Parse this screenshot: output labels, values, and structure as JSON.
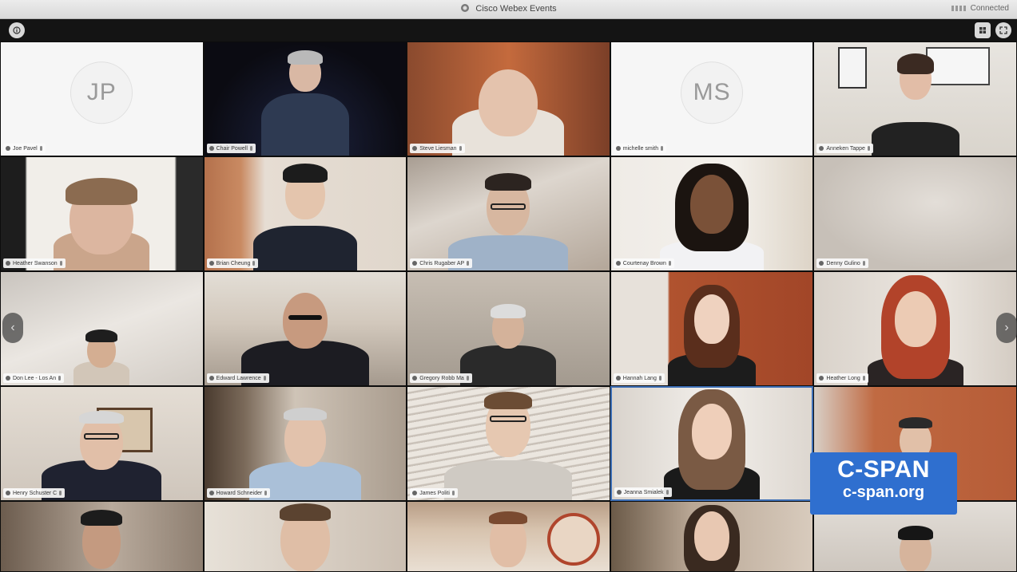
{
  "window": {
    "title": "Cisco Webex Events",
    "status": "Connected",
    "title_icon": "webex-logo-icon"
  },
  "toolbar": {
    "left_icon": "info-icon",
    "right_icons": [
      "grid-view-icon",
      "fullscreen-icon"
    ]
  },
  "participants": [
    {
      "name": "Joe Pavel",
      "initials": "JP",
      "avatar": true
    },
    {
      "name": "Chair Powell"
    },
    {
      "name": "Steve Liesman"
    },
    {
      "name": "michelle smith",
      "initials": "MS",
      "avatar": true
    },
    {
      "name": "Anneken Tappe"
    },
    {
      "name": "Heather Swanson"
    },
    {
      "name": "Brian Cheung"
    },
    {
      "name": "Chris Rugaber AP"
    },
    {
      "name": "Courtenay Brown"
    },
    {
      "name": "Denny Gulino"
    },
    {
      "name": "Don Lee - Los An"
    },
    {
      "name": "Edward Lawrence"
    },
    {
      "name": "Gregory Robb Ma"
    },
    {
      "name": "Hannah Lang"
    },
    {
      "name": "Heather Long"
    },
    {
      "name": "Henry Schuster C"
    },
    {
      "name": "Howard Schneider"
    },
    {
      "name": "James Politi"
    },
    {
      "name": "Jeanna Smialek"
    },
    {
      "name": ""
    },
    {
      "name": ""
    },
    {
      "name": ""
    },
    {
      "name": ""
    },
    {
      "name": ""
    },
    {
      "name": ""
    }
  ],
  "navigation": {
    "prev_icon": "chevron-left-icon",
    "next_icon": "chevron-right-icon",
    "prev_glyph": "‹",
    "next_glyph": "›"
  },
  "watermark": {
    "logo": "C-SPAN",
    "url": "c-span.org"
  }
}
